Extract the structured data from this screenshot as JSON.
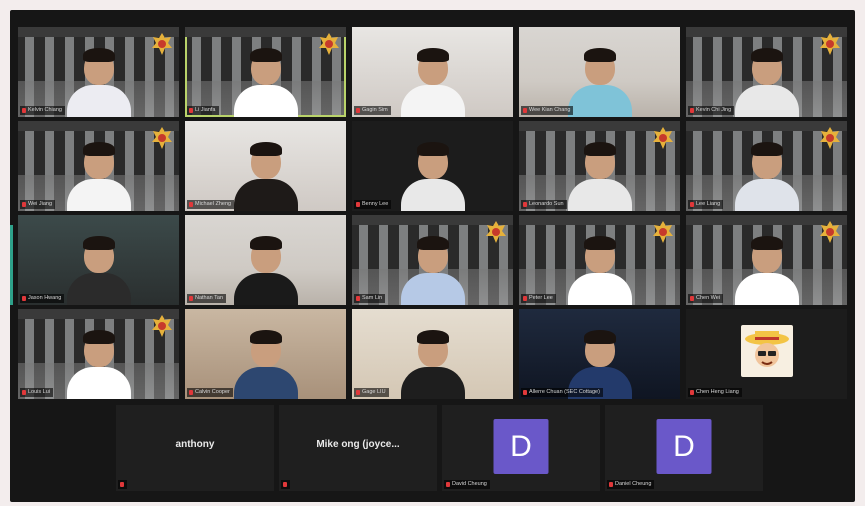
{
  "meeting": {
    "tiles": [
      {
        "name": "Kelvin Chiang",
        "bg": "office",
        "emblem": true,
        "shirt": "#ececf2"
      },
      {
        "name": "Li Jianfa",
        "bg": "office",
        "emblem": true,
        "shirt": "#ffffff",
        "active": true
      },
      {
        "name": "Gagin Sim",
        "bg": "light",
        "emblem": false,
        "shirt": "#f4f4f4"
      },
      {
        "name": "Wee Kian Chang",
        "bg": "room",
        "emblem": false,
        "shirt": "#7fc3d8"
      },
      {
        "name": "Kevin Chi Jing",
        "bg": "office",
        "emblem": true,
        "shirt": "#e8e8e8"
      },
      {
        "name": "Wei Jiang",
        "bg": "office",
        "emblem": true,
        "shirt": "#f4f4f4"
      },
      {
        "name": "Michael Zheng",
        "bg": "light",
        "emblem": false,
        "shirt": "#1e1a18"
      },
      {
        "name": "Benny Lee",
        "bg": "plain",
        "emblem": false,
        "shirt": "#e8e8e8"
      },
      {
        "name": "Leonardo Sun",
        "bg": "office",
        "emblem": true,
        "shirt": "#e8e8e8"
      },
      {
        "name": "Lee Liang",
        "bg": "office",
        "emblem": true,
        "shirt": "#dfe3ea"
      },
      {
        "name": "Jason Hwang",
        "bg": "dark",
        "emblem": false,
        "shirt": "#2b2b2b"
      },
      {
        "name": "Nathan Tan",
        "bg": "room",
        "emblem": false,
        "shirt": "#1a1a1a"
      },
      {
        "name": "Sam Lin",
        "bg": "office",
        "emblem": true,
        "shirt": "#b6c9e6"
      },
      {
        "name": "Peter Lee",
        "bg": "office",
        "emblem": true,
        "shirt": "#ffffff"
      },
      {
        "name": "Chen Wei",
        "bg": "office",
        "emblem": true,
        "shirt": "#ffffff"
      },
      {
        "name": "Louis Lui",
        "bg": "office",
        "emblem": true,
        "shirt": "#ffffff"
      },
      {
        "name": "Calvin Cooper",
        "bg": "warm",
        "emblem": false,
        "shirt": "#2d4770"
      },
      {
        "name": "Gage LIU",
        "bg": "beige",
        "emblem": false,
        "shirt": "#1e1e1e"
      },
      {
        "name": "Allerre Chuan (SEC Cottage)",
        "bg": "navy",
        "emblem": false,
        "shirt": "#233a6b"
      },
      {
        "name": "Chen Heng Liang",
        "bg": "plain",
        "emblem": false,
        "shirt": "",
        "cartoon": true
      }
    ],
    "bottom_tiles": [
      {
        "label": "anthony",
        "type": "text",
        "name": ""
      },
      {
        "label": "Mike ong (joyce...",
        "type": "text",
        "name": ""
      },
      {
        "label": "D",
        "type": "avatar",
        "name": "David Cheung"
      },
      {
        "label": "D",
        "type": "avatar",
        "name": "Daniel Cheung"
      }
    ]
  },
  "colors": {
    "active_border": "#b9d36a",
    "avatar": "#6a58c9",
    "muted_mic": "#e0383a"
  },
  "icons": {
    "mic": "muted-mic-icon",
    "emblem": "crest-emblem-icon"
  }
}
